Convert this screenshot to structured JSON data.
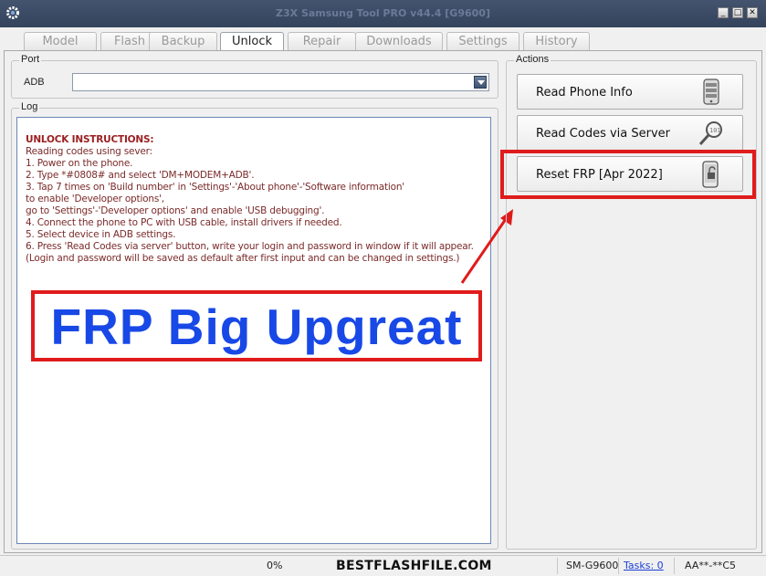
{
  "window": {
    "title": "Z3X Samsung Tool PRO v44.4 [G9600]",
    "controls": {
      "minimize": "_",
      "maximize": "□",
      "close": "✕"
    }
  },
  "tabs": [
    {
      "label": "Model"
    },
    {
      "label": "Flash"
    },
    {
      "label": "Backup"
    },
    {
      "label": "Unlock",
      "active": true
    },
    {
      "label": "Repair"
    },
    {
      "label": "Downloads"
    },
    {
      "label": "Settings"
    },
    {
      "label": "History"
    }
  ],
  "port": {
    "group_title": "Port",
    "label": "ADB",
    "value": ""
  },
  "log": {
    "group_title": "Log",
    "lines": [
      "UNLOCK INSTRUCTIONS:",
      "  Reading codes using sever:",
      "1. Power on the phone.",
      "2. Type *#0808# and select 'DM+MODEM+ADB'.",
      "3. Tap 7 times on 'Build number' in 'Settings'-'About phone'-'Software information'",
      "   to enable 'Developer options',",
      "   go to 'Settings'-'Developer options' and enable 'USB debugging'.",
      "4. Connect the phone to PC with USB cable, install drivers if needed.",
      "5. Select device in ADB settings.",
      "6. Press 'Read Codes via server' button, write your login and password in window if it will appear.",
      "  (Login and password will be saved as default after first input and can be changed in settings.)"
    ]
  },
  "actions": {
    "group_title": "Actions",
    "buttons": [
      {
        "label": "Read Phone Info",
        "icon": "phone-info-icon"
      },
      {
        "label": "Read Codes via Server",
        "icon": "magnifier-code-icon"
      },
      {
        "label": "Reset FRP [Apr 2022]",
        "icon": "phone-unlock-icon"
      }
    ]
  },
  "promo": {
    "text": "FRP Big Upgreat",
    "color": "#1848e6",
    "frame_color": "#e01b1b"
  },
  "status": {
    "progress": "0%",
    "model": "SM-G9600",
    "tasks_label": "Tasks: 0",
    "code": "AA**-**C5"
  },
  "watermark": "BESTFLASHFILE.COM"
}
